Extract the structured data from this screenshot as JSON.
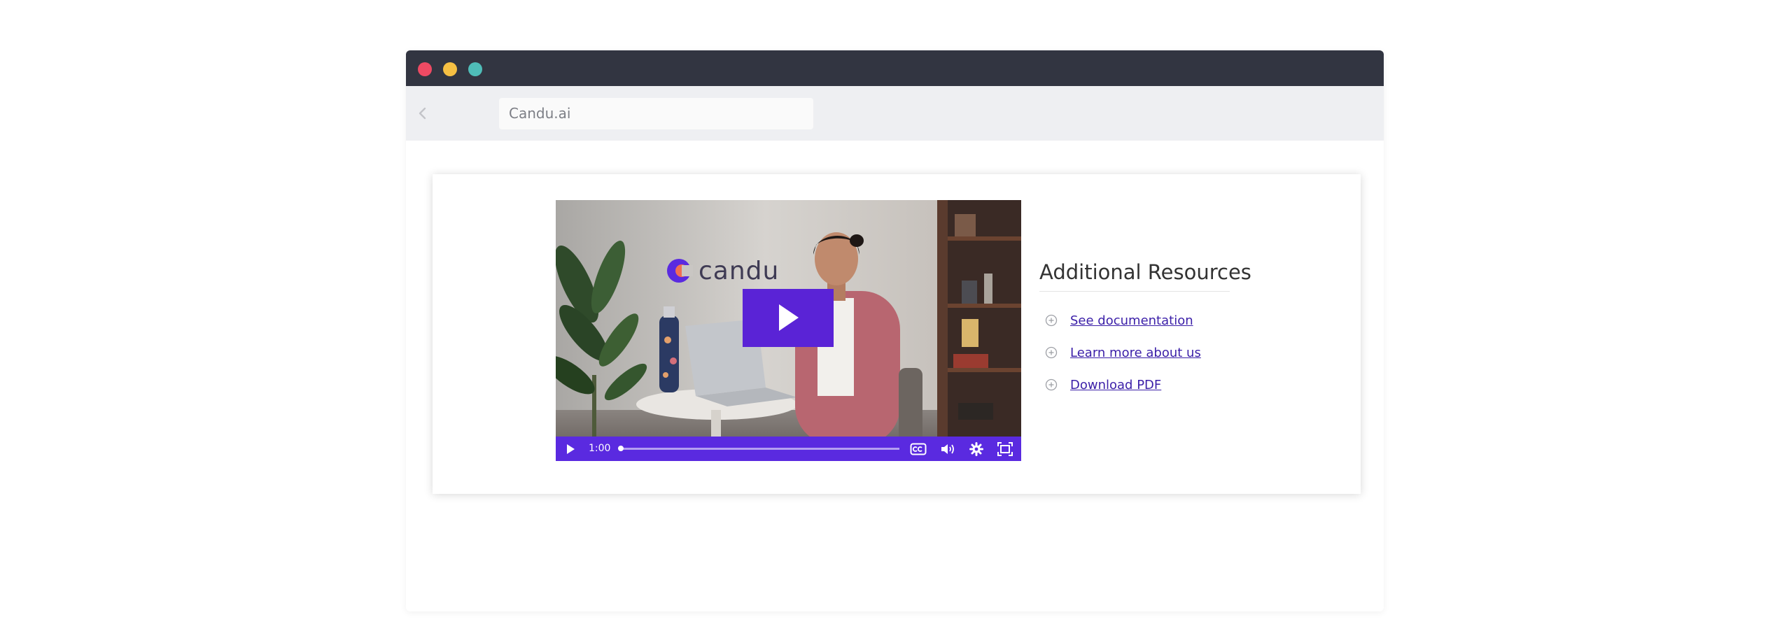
{
  "browser": {
    "address": "Candu.ai"
  },
  "video": {
    "logo_text": "candu",
    "current_time": "1:00",
    "progress": 0.005,
    "accent_color": "#5a2ae0"
  },
  "resources": {
    "title": "Additional Resources",
    "links": [
      {
        "label": "See documentation",
        "icon": "plus-circle-icon"
      },
      {
        "label": "Learn more about us",
        "icon": "plus-circle-icon"
      },
      {
        "label": "Download PDF",
        "icon": "plus-circle-icon"
      }
    ],
    "link_color": "#3b1fa8"
  }
}
